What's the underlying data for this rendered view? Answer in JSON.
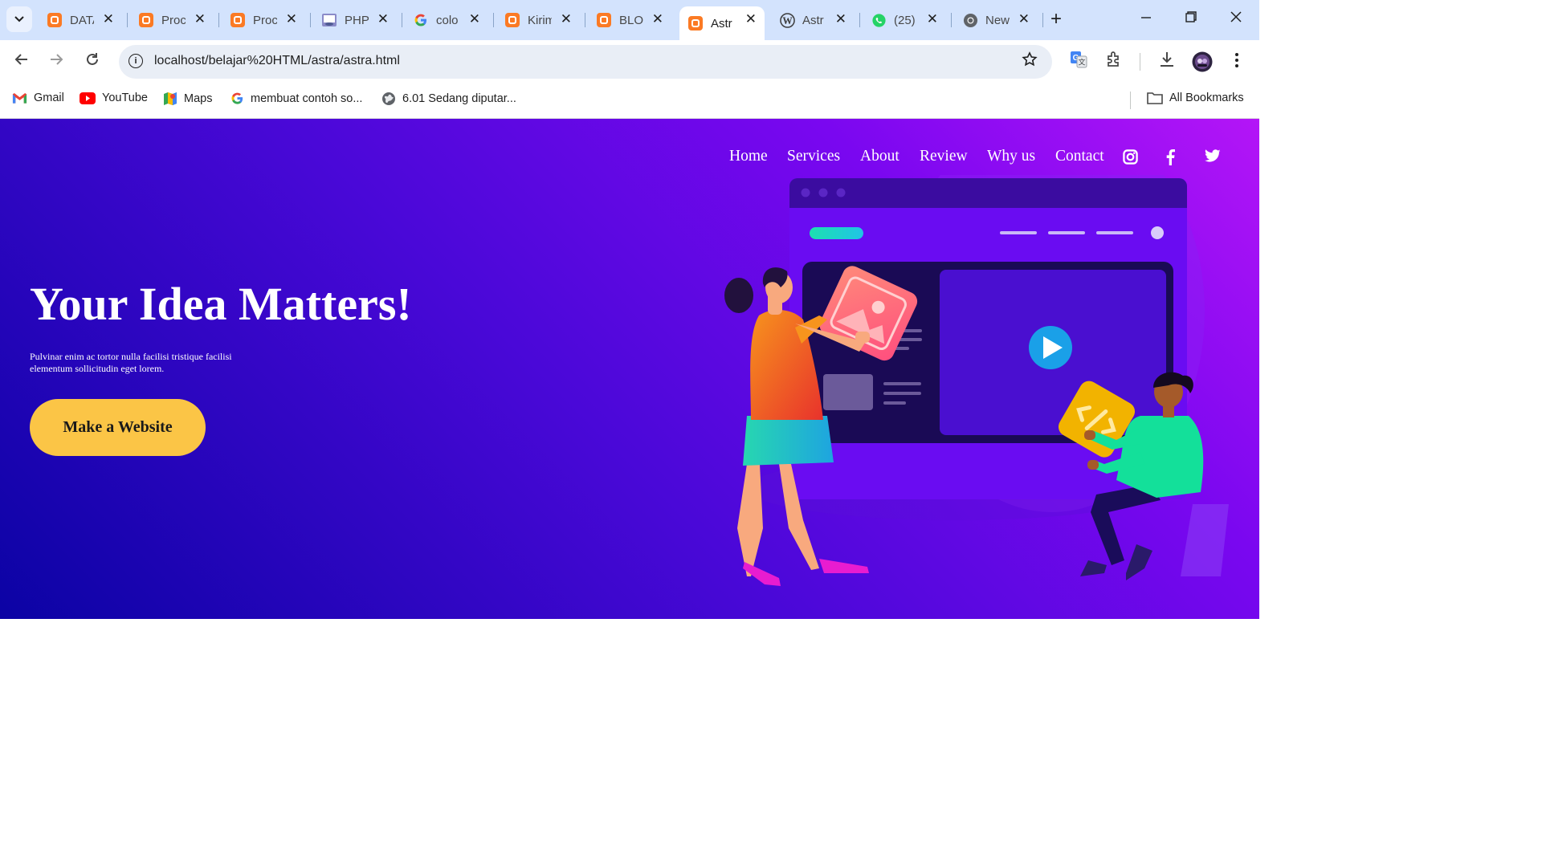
{
  "browser": {
    "tabs": [
      {
        "title": "DATA",
        "icon": "xampp-icon"
      },
      {
        "title": "Proc",
        "icon": "xampp-icon"
      },
      {
        "title": "Proc",
        "icon": "xampp-icon"
      },
      {
        "title": "PHP",
        "icon": "php-icon"
      },
      {
        "title": "colo",
        "icon": "google-icon"
      },
      {
        "title": "Kirim",
        "icon": "xampp-icon"
      },
      {
        "title": "BLO",
        "icon": "xampp-icon"
      },
      {
        "title": "Astr",
        "icon": "xampp-icon",
        "active": true
      },
      {
        "title": "Astr",
        "icon": "wordpress-icon"
      },
      {
        "title": "(25)",
        "icon": "whatsapp-icon"
      },
      {
        "title": "New",
        "icon": "chrome-icon"
      }
    ],
    "url": "localhost/belajar%20HTML/astra/astra.html",
    "bookmarks": [
      {
        "label": "Gmail",
        "icon": "gmail-icon"
      },
      {
        "label": "YouTube",
        "icon": "youtube-icon"
      },
      {
        "label": "Maps",
        "icon": "maps-icon"
      },
      {
        "label": "membuat contoh so...",
        "icon": "google-icon"
      },
      {
        "label": "6.01 Sedang diputar...",
        "icon": "globe-icon"
      }
    ],
    "all_bookmarks": "All Bookmarks"
  },
  "site": {
    "nav": [
      "Home",
      "Services",
      "About",
      "Review",
      "Why us",
      "Contact"
    ],
    "social": [
      "instagram-icon",
      "facebook-icon",
      "twitter-icon"
    ],
    "hero": {
      "title": "Your Idea Matters!",
      "subtitle": "Pulvinar enim ac tortor nulla facilisi tristique facilisi elementum sollicitudin eget lorem.",
      "cta": "Make a Website"
    },
    "colors": {
      "accent": "#fbc546",
      "gradient_start": "#b415f7",
      "gradient_end": "#0b03a4"
    }
  }
}
